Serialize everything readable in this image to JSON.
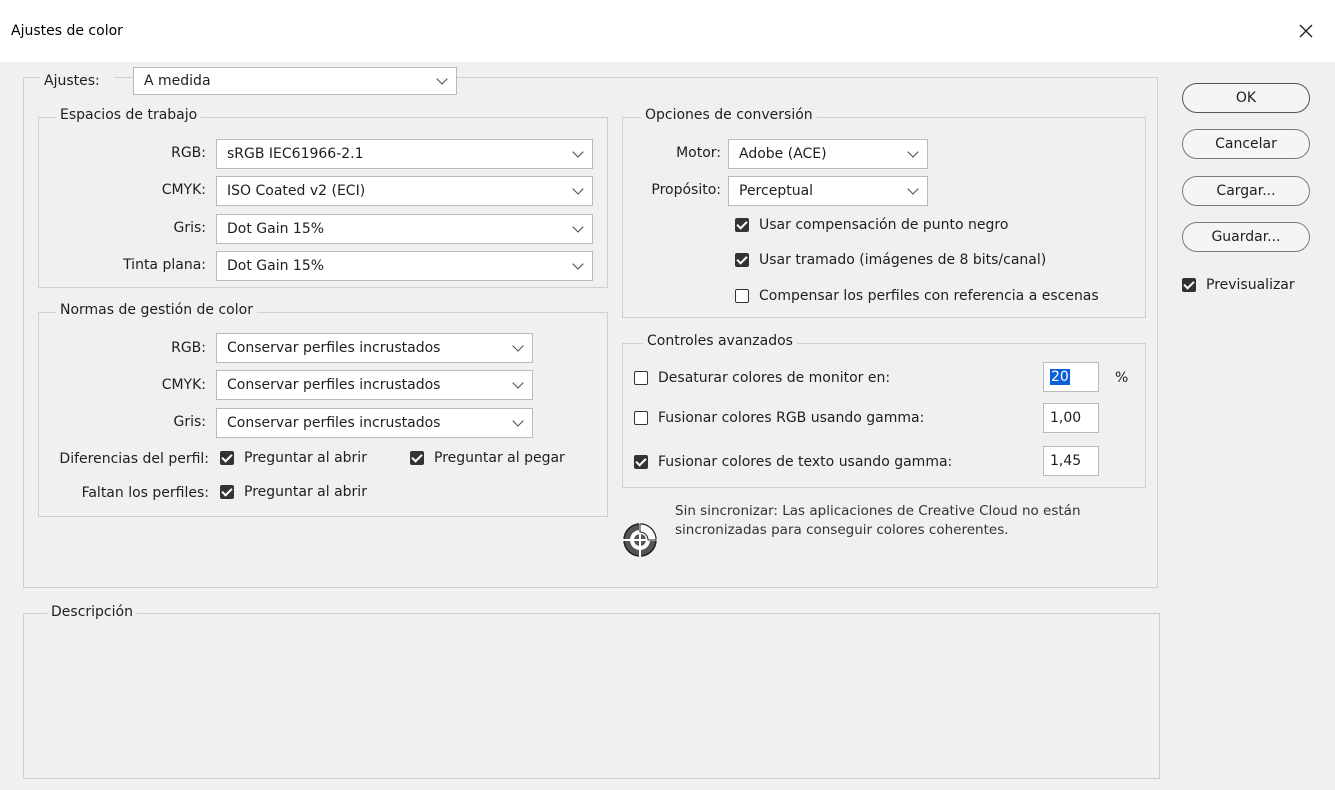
{
  "window": {
    "title": "Ajustes de color"
  },
  "settings": {
    "label": "Ajustes:",
    "value": "A medida"
  },
  "working_spaces": {
    "legend": "Espacios de trabajo",
    "rows": [
      {
        "label": "RGB:",
        "value": "sRGB IEC61966-2.1"
      },
      {
        "label": "CMYK:",
        "value": "ISO Coated v2 (ECI)"
      },
      {
        "label": "Gris:",
        "value": "Dot Gain 15%"
      },
      {
        "label": "Tinta plana:",
        "value": "Dot Gain 15%"
      }
    ]
  },
  "policies": {
    "legend": "Normas de gestión de color",
    "rows": [
      {
        "label": "RGB:",
        "value": "Conservar perfiles incrustados"
      },
      {
        "label": "CMYK:",
        "value": "Conservar perfiles incrustados"
      },
      {
        "label": "Gris:",
        "value": "Conservar perfiles incrustados"
      }
    ],
    "mismatch_label": "Diferencias del perfil:",
    "mismatch_open": {
      "label": "Preguntar al abrir",
      "checked": true
    },
    "mismatch_paste": {
      "label": "Preguntar al pegar",
      "checked": true
    },
    "missing_label": "Faltan los perfiles:",
    "missing_open": {
      "label": "Preguntar al abrir",
      "checked": true
    }
  },
  "conversion": {
    "legend": "Opciones de conversión",
    "engine_label": "Motor:",
    "engine_value": "Adobe (ACE)",
    "intent_label": "Propósito:",
    "intent_value": "Perceptual",
    "black_point": {
      "label": "Usar compensación de punto negro",
      "checked": true
    },
    "dither": {
      "label": "Usar tramado (imágenes de 8 bits/canal)",
      "checked": true
    },
    "scene": {
      "label": "Compensar los perfiles con referencia a escenas",
      "checked": false
    }
  },
  "advanced": {
    "legend": "Controles avanzados",
    "desaturate": {
      "label": "Desaturar colores de monitor en:",
      "checked": false,
      "value": "20",
      "unit": "%"
    },
    "blend_rgb": {
      "label": "Fusionar colores RGB usando gamma:",
      "checked": false,
      "value": "1,00"
    },
    "blend_text": {
      "label": "Fusionar colores de texto usando gamma:",
      "checked": true,
      "value": "1,45"
    }
  },
  "sync": {
    "line1": "Sin sincronizar: Las aplicaciones de Creative Cloud no están",
    "line2": "sincronizadas para conseguir colores coherentes.",
    "icon": "sync-status-icon"
  },
  "description": {
    "legend": "Descripción"
  },
  "buttons": {
    "ok": "OK",
    "cancel": "Cancelar",
    "load": "Cargar...",
    "save": "Guardar..."
  },
  "preview": {
    "label": "Previsualizar",
    "checked": true
  },
  "colors": {
    "selection": "#0a5fd6",
    "background": "#f0f0f0"
  }
}
